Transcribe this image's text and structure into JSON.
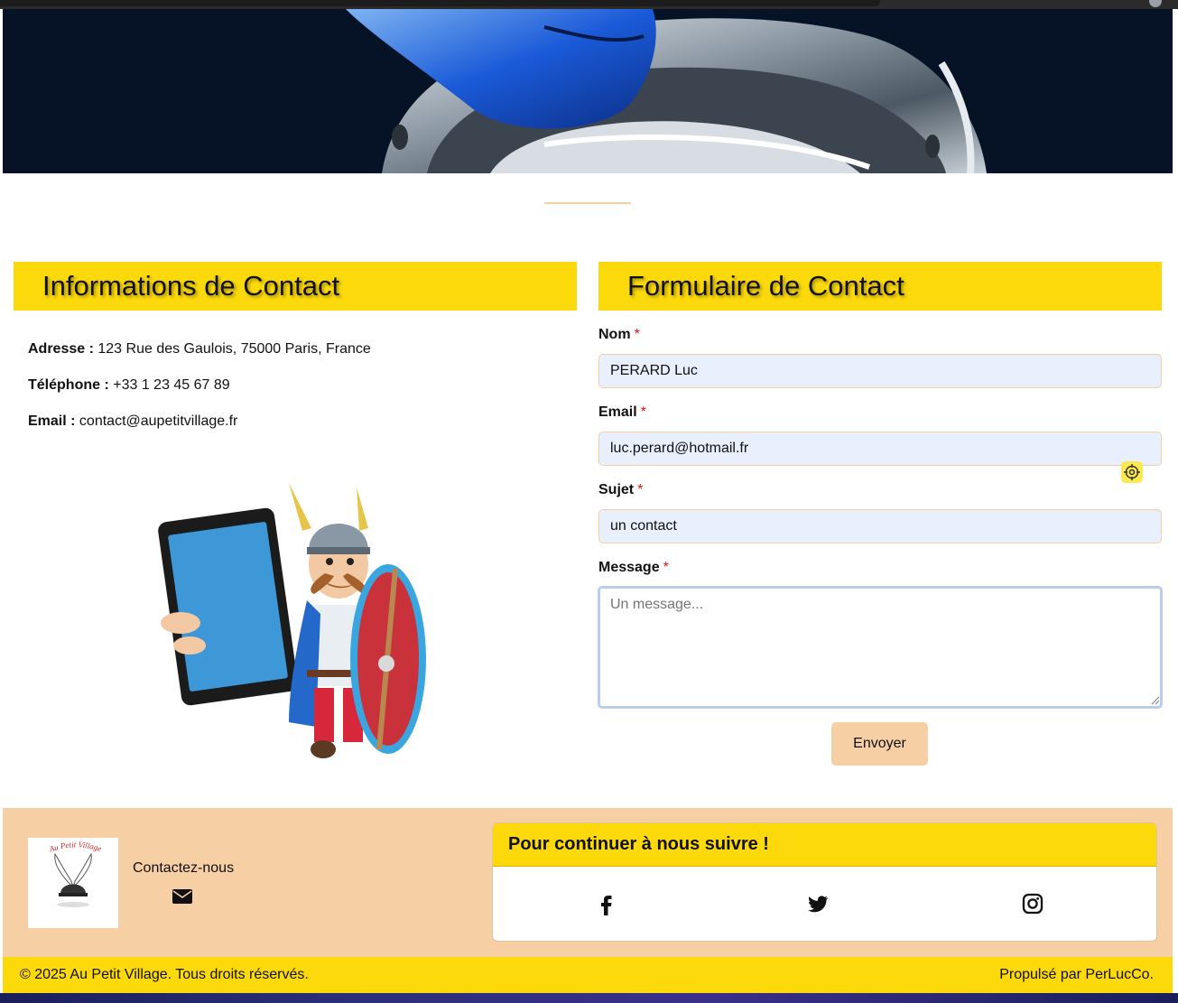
{
  "info": {
    "title": "Informations de Contact",
    "address_label": "Adresse :",
    "address_value": "123 Rue des Gaulois, 75000 Paris, France",
    "phone_label": "Téléphone :",
    "phone_value": "+33 1 23 45 67 89",
    "email_label": "Email :",
    "email_value": "contact@aupetitvillage.fr"
  },
  "form": {
    "title": "Formulaire de Contact",
    "required_mark": "*",
    "name_label": "Nom",
    "name_value": "PERARD Luc",
    "email_label": "Email",
    "email_value": "luc.perard@hotmail.fr",
    "subject_label": "Sujet",
    "subject_value": "un contact",
    "message_label": "Message",
    "message_placeholder": "Un message...",
    "submit_label": "Envoyer"
  },
  "footer": {
    "logo_text": "Au Petit Village",
    "contact_label": "Contactez-nous",
    "follow_title": "Pour continuer à nous suivre !",
    "social_icons": [
      "facebook-icon",
      "twitter-icon",
      "instagram-icon"
    ],
    "copyright": "© 2025 Au Petit Village. Tous droits réservés.",
    "powered_by": "Propulsé par PerLucCo."
  },
  "colors": {
    "accent_yellow": "#fcd90b",
    "accent_peach": "#f7cfa5",
    "input_bg": "#e8f0fe",
    "hero_bg": "#061327"
  }
}
